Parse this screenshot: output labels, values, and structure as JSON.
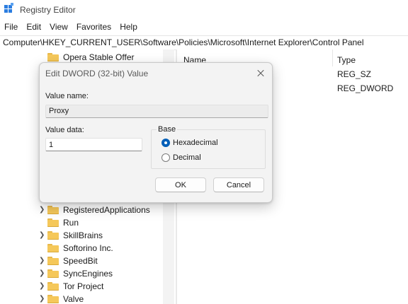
{
  "window": {
    "title": "Registry Editor",
    "icon": "registry-editor-icon"
  },
  "menu": {
    "items": [
      "File",
      "Edit",
      "View",
      "Favorites",
      "Help"
    ]
  },
  "address": {
    "value": "Computer\\HKEY_CURRENT_USER\\Software\\Policies\\Microsoft\\Internet Explorer\\Control Panel"
  },
  "tree": {
    "items": [
      {
        "label": "Opera Stable Offer",
        "expandable": false
      },
      {
        "label": "RegisteredApplications",
        "expandable": true
      },
      {
        "label": "Run",
        "expandable": false
      },
      {
        "label": "SkillBrains",
        "expandable": true
      },
      {
        "label": "Softorino Inc.",
        "expandable": false
      },
      {
        "label": "SpeedBit",
        "expandable": true
      },
      {
        "label": "SyncEngines",
        "expandable": true
      },
      {
        "label": "Tor Project",
        "expandable": true
      },
      {
        "label": "Valve",
        "expandable": true
      }
    ]
  },
  "values_pane": {
    "columns": {
      "name": "Name",
      "type": "Type"
    },
    "rows": [
      {
        "type": "REG_SZ"
      },
      {
        "type": "REG_DWORD"
      }
    ]
  },
  "dialog": {
    "title": "Edit DWORD (32-bit) Value",
    "value_name_label": "Value name:",
    "value_name": "Proxy",
    "value_data_label": "Value data:",
    "value_data": "1",
    "base_label": "Base",
    "base_options": [
      "Hexadecimal",
      "Decimal"
    ],
    "selected_base": "Hexadecimal",
    "ok_label": "OK",
    "cancel_label": "Cancel"
  },
  "colors": {
    "accent": "#005fb8",
    "folder": "#f5c85a",
    "dialog_bg": "#f3f3f3"
  }
}
